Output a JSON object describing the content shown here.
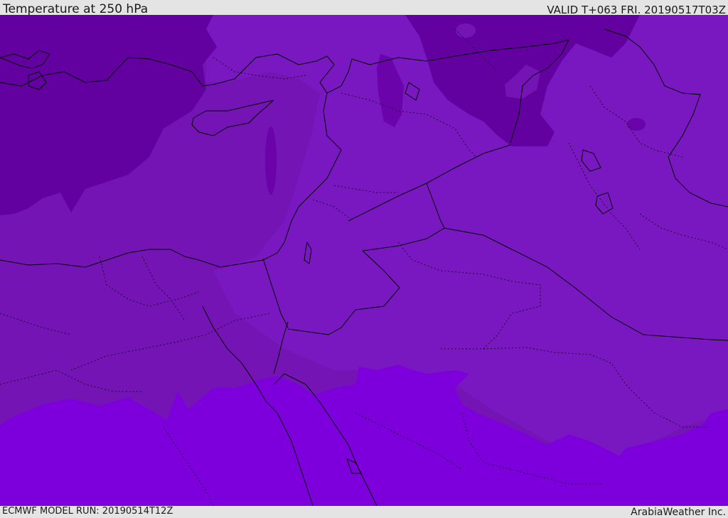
{
  "header": {
    "title": "Temperature at 250 hPa",
    "valid": "VALID T+063 FRI. 20190517T03Z"
  },
  "footer": {
    "model_run": "ECMWF MODEL RUN: 20190514T12Z",
    "brand": "ArabiaWeather Inc."
  },
  "map": {
    "fill_colors": {
      "coldest": "#6300a0",
      "cold": "#7414b4",
      "mid": "#7918c0",
      "warm": "#7d00dc"
    },
    "boundary_color": "#000000"
  }
}
